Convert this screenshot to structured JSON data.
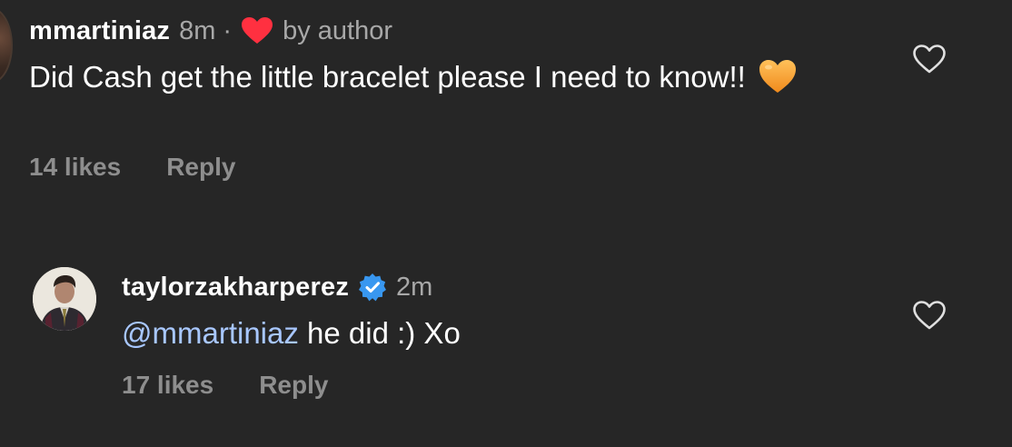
{
  "comments": [
    {
      "username": "mmartiniaz",
      "time": "8m",
      "separator": "·",
      "author_badge": "by author",
      "text": "Did Cash get the little bracelet please I need to know!!",
      "emoji": "orange-heart",
      "likes": "14 likes",
      "reply_label": "Reply",
      "liked_by_author_icon": "red-heart-icon",
      "like_icon": "heart-outline-icon"
    },
    {
      "username": "taylorzakharperez",
      "verified_icon": "verified-badge-icon",
      "time": "2m",
      "mention": "@mmartiniaz",
      "text": " he did :) Xo",
      "likes": "17 likes",
      "reply_label": "Reply",
      "like_icon": "heart-outline-icon"
    }
  ],
  "colors": {
    "background": "#262626",
    "text": "#ffffff",
    "secondary": "#a8a8a8",
    "muted": "#8e8e8e",
    "mention": "#a8c7ff",
    "red_heart": "#ff3040",
    "verified": "#3897f0",
    "orange_heart": "#f7a23b"
  }
}
